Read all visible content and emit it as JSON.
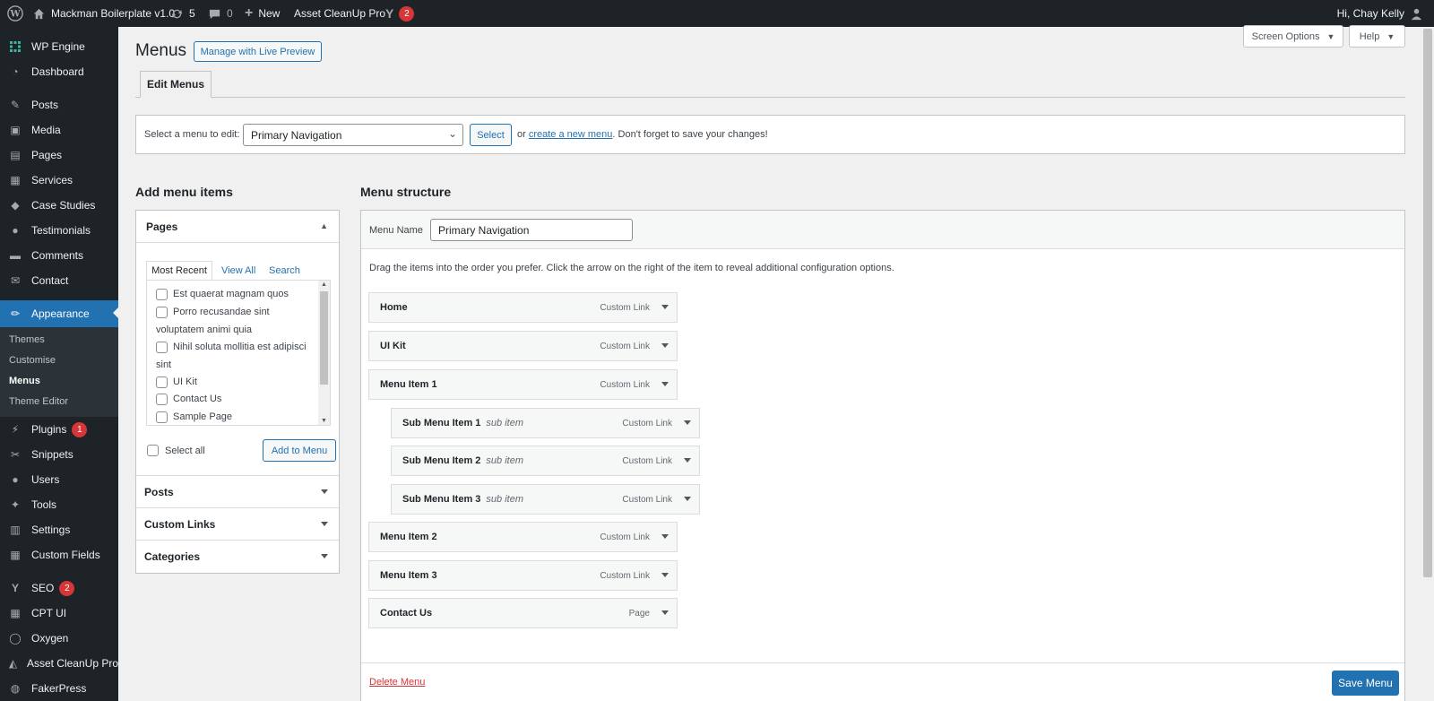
{
  "adminbar": {
    "site_name": "Mackman Boilerplate v1.0",
    "updates_count": "5",
    "comments_count": "0",
    "new_label": "New",
    "asset_cleanup_label": "Asset CleanUp Pro",
    "yoast_badge": "2",
    "greeting": "Hi, Chay Kelly"
  },
  "sidebar": {
    "items": [
      {
        "label": "WP Engine",
        "icon": "wpengine-icon"
      },
      {
        "label": "Dashboard",
        "icon": "dashboard-icon"
      },
      {
        "label": "Posts",
        "icon": "pin-icon"
      },
      {
        "label": "Media",
        "icon": "media-icon"
      },
      {
        "label": "Pages",
        "icon": "pages-icon"
      },
      {
        "label": "Services",
        "icon": "store-icon"
      },
      {
        "label": "Case Studies",
        "icon": "tag-icon"
      },
      {
        "label": "Testimonials",
        "icon": "chat-icon"
      },
      {
        "label": "Comments",
        "icon": "comment-icon"
      },
      {
        "label": "Contact",
        "icon": "mail-icon"
      },
      {
        "label": "Appearance",
        "icon": "brush-icon"
      },
      {
        "label": "Plugins",
        "icon": "plugin-icon",
        "badge": "1"
      },
      {
        "label": "Snippets",
        "icon": "scissors-icon"
      },
      {
        "label": "Users",
        "icon": "user-icon"
      },
      {
        "label": "Tools",
        "icon": "wrench-icon"
      },
      {
        "label": "Settings",
        "icon": "settings-icon"
      },
      {
        "label": "Custom Fields",
        "icon": "grid-icon"
      },
      {
        "label": "SEO",
        "icon": "yoast-icon",
        "badge": "2"
      },
      {
        "label": "CPT UI",
        "icon": "cpt-icon"
      },
      {
        "label": "Oxygen",
        "icon": "oxygen-icon"
      },
      {
        "label": "Asset CleanUp Pro",
        "icon": "cleanup-icon"
      },
      {
        "label": "FakerPress",
        "icon": "faker-icon"
      }
    ],
    "appearance_sub": [
      "Themes",
      "Customise",
      "Menus",
      "Theme Editor"
    ]
  },
  "header": {
    "title": "Menus",
    "live_preview": "Manage with Live Preview",
    "screen_options": "Screen Options",
    "help": "Help"
  },
  "tabs": {
    "edit_menus": "Edit Menus"
  },
  "select_bar": {
    "label": "Select a menu to edit:",
    "selected": "Primary Navigation",
    "select_button": "Select",
    "or": "or",
    "create_link": "create a new menu",
    "reminder": ". Don't forget to save your changes!"
  },
  "add_items": {
    "heading": "Add menu items",
    "pages_title": "Pages",
    "tabs": [
      "Most Recent",
      "View All",
      "Search"
    ],
    "pages": [
      "Est quaerat magnam quos",
      "Porro recusandae sint voluptatem animi quia",
      "Nihil soluta mollitia est adipisci sint",
      "UI Kit",
      "Contact Us",
      "Sample Page"
    ],
    "select_all": "Select all",
    "add_button": "Add to Menu",
    "sections": [
      "Posts",
      "Custom Links",
      "Categories"
    ]
  },
  "structure": {
    "heading": "Menu structure",
    "name_label": "Menu Name",
    "name_value": "Primary Navigation",
    "instructions": "Drag the items into the order you prefer. Click the arrow on the right of the item to reveal additional configuration options.",
    "items": [
      {
        "title": "Home",
        "type": "Custom Link",
        "sub": ""
      },
      {
        "title": "UI Kit",
        "type": "Custom Link",
        "sub": ""
      },
      {
        "title": "Menu Item 1",
        "type": "Custom Link",
        "sub": ""
      },
      {
        "title": "Sub Menu Item 1",
        "type": "Custom Link",
        "sub": "sub item"
      },
      {
        "title": "Sub Menu Item 2",
        "type": "Custom Link",
        "sub": "sub item"
      },
      {
        "title": "Sub Menu Item 3",
        "type": "Custom Link",
        "sub": "sub item"
      },
      {
        "title": "Menu Item 2",
        "type": "Custom Link",
        "sub": ""
      },
      {
        "title": "Menu Item 3",
        "type": "Custom Link",
        "sub": ""
      },
      {
        "title": "Contact Us",
        "type": "Page",
        "sub": ""
      }
    ],
    "delete_link": "Delete Menu",
    "save_button": "Save Menu"
  }
}
